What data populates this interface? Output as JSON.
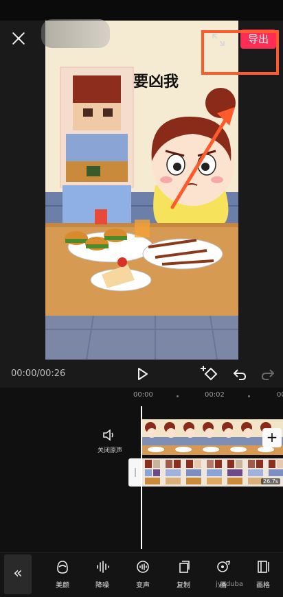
{
  "header": {
    "export_label": "导出"
  },
  "preview": {
    "caption_text": "要凶我"
  },
  "playback": {
    "timecode": "00:00/00:26"
  },
  "timeline": {
    "ruler": [
      "00:00",
      "00:02",
      "00"
    ],
    "mute_label": "关闭原声",
    "overlay_duration": "26.7s"
  },
  "toolbar": {
    "tools": [
      {
        "label": "美颜",
        "icon": "face-icon"
      },
      {
        "label": "降噪",
        "icon": "waveform-icon"
      },
      {
        "label": "变声",
        "icon": "voice-change-icon"
      },
      {
        "label": "复制",
        "icon": "copy-icon"
      },
      {
        "label": "画",
        "icon": "picture-icon"
      },
      {
        "label": "画格",
        "icon": "frame-icon"
      }
    ]
  },
  "watermark": "jyaduba",
  "colors": {
    "accent": "#ff2d55",
    "highlight": "#ff5a2c",
    "background": "#121212"
  }
}
